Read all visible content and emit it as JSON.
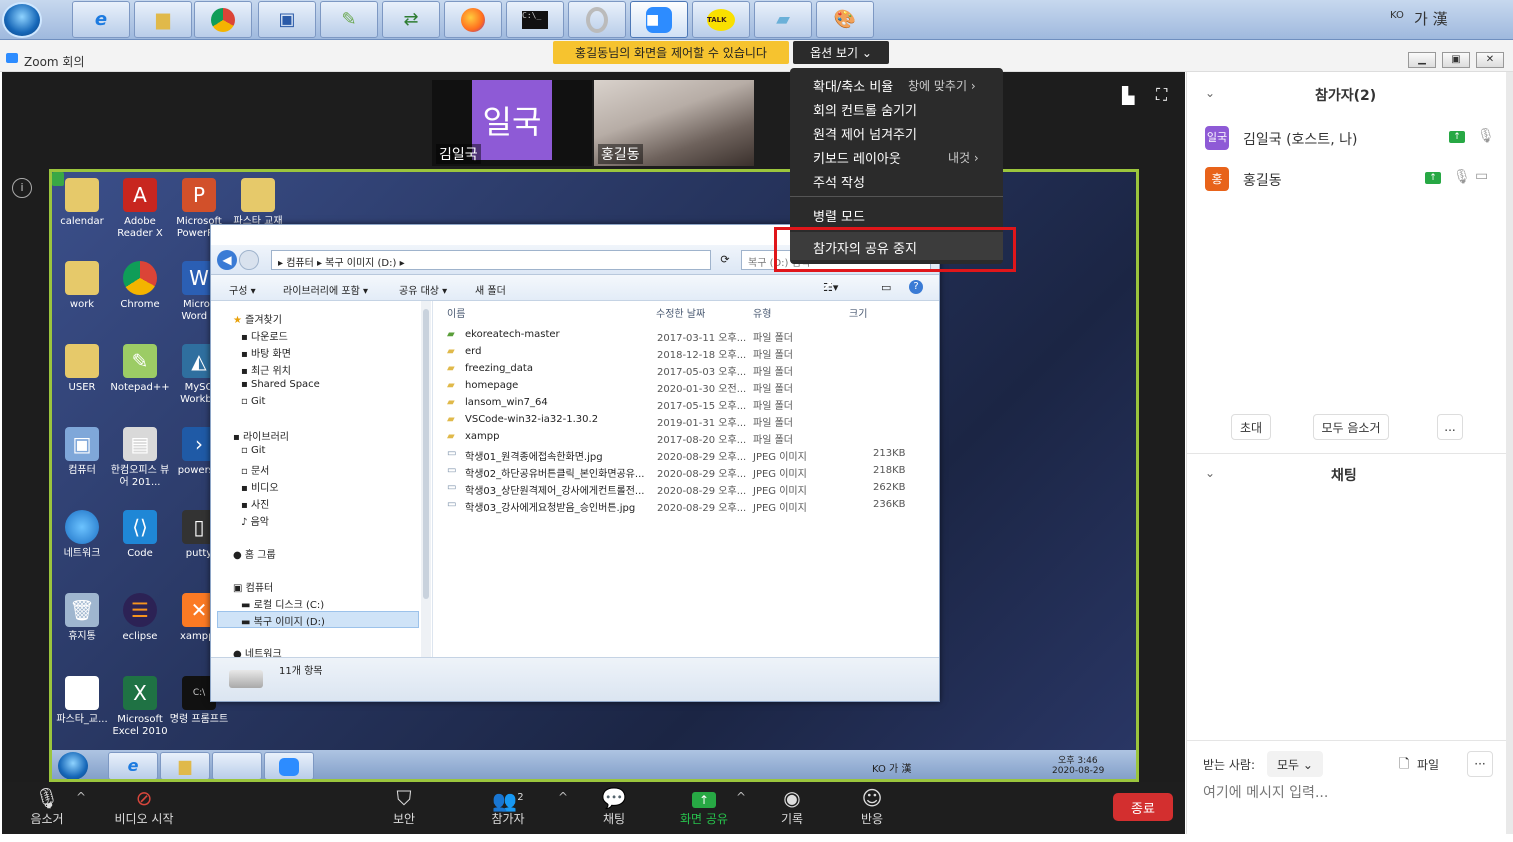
{
  "taskbar": {
    "apps": [
      "ie-icon",
      "folder-icon",
      "chrome-icon",
      "network-icon",
      "notepad-icon",
      "transfer-icon",
      "firefox-icon",
      "cmd-icon",
      "opera-icon",
      "zoom-icon",
      "kakaotalk-icon",
      "note-icon",
      "paint-icon"
    ],
    "kakao_label": "TALK",
    "ime_lang": "KO",
    "ime_text": "가 漢"
  },
  "zoom": {
    "title": "Zoom 회의",
    "banner": "홍길동님의 화면을 제어할 수 있습니다",
    "view_options": "옵션 보기 ⌄"
  },
  "thumbnails": [
    {
      "avatar_text": "일국",
      "name": "김일국"
    },
    {
      "name": "홍길동"
    }
  ],
  "menu": {
    "items": [
      {
        "label": "확대/축소 비율",
        "value": "창에 맞추기 ›"
      },
      {
        "label": "회의 컨트롤 숨기기"
      },
      {
        "label": "원격 제어 넘겨주기"
      },
      {
        "label": "키보드 레이아웃",
        "value": "내것 ›"
      },
      {
        "label": "주석 작성"
      },
      {
        "label": "병렬 모드"
      },
      {
        "label": "참가자의 공유 중지"
      }
    ]
  },
  "desktop_icons": [
    {
      "label": "calendar"
    },
    {
      "label": "Adobe Reader X"
    },
    {
      "label": "Microsoft PowerP..."
    },
    {
      "label": "파스타 교재"
    },
    {
      "label": "work"
    },
    {
      "label": "Chrome"
    },
    {
      "label": "Micros Word 2"
    },
    {
      "label": "USER"
    },
    {
      "label": "Notepad++"
    },
    {
      "label": "MySQ Workbe"
    },
    {
      "label": "컴퓨터"
    },
    {
      "label": "한컴오피스 뷰어 201..."
    },
    {
      "label": "powersh"
    },
    {
      "label": "네트워크"
    },
    {
      "label": "Code"
    },
    {
      "label": "putty"
    },
    {
      "label": "휴지통"
    },
    {
      "label": "eclipse"
    },
    {
      "label": "xampp-"
    },
    {
      "label": "파스타_교..."
    },
    {
      "label": "Microsoft Excel 2010"
    },
    {
      "label": "명령 프롬프트"
    }
  ],
  "explorer": {
    "breadcrumb": "▸ 컴퓨터 ▸ 복구 이미지 (D:) ▸",
    "search_placeholder": "복구 (D:) 검색",
    "commands": [
      "구성 ▾",
      "라이브러리에 포함 ▾",
      "공유 대상 ▾",
      "새 폴더"
    ],
    "nav": [
      "즐겨찾기",
      "다운로드",
      "바탕 화면",
      "최근 위치",
      "Shared Space",
      "Git",
      "라이브러리",
      "Git",
      "문서",
      "비디오",
      "사진",
      "음악",
      "홈 그룹",
      "컴퓨터",
      "로컬 디스크 (C:)",
      "복구 이미지 (D:)",
      "네트워크"
    ],
    "columns": [
      "이름",
      "수정한 날짜",
      "유형",
      "크기"
    ],
    "files": [
      {
        "name": "ekoreatech-master",
        "date": "2017-03-11 오후...",
        "type": "파일 폴더",
        "size": ""
      },
      {
        "name": "erd",
        "date": "2018-12-18 오후...",
        "type": "파일 폴더",
        "size": ""
      },
      {
        "name": "freezing_data",
        "date": "2017-05-03 오후...",
        "type": "파일 폴더",
        "size": ""
      },
      {
        "name": "homepage",
        "date": "2020-01-30 오전...",
        "type": "파일 폴더",
        "size": ""
      },
      {
        "name": "lansom_win7_64",
        "date": "2017-05-15 오후...",
        "type": "파일 폴더",
        "size": ""
      },
      {
        "name": "VSCode-win32-ia32-1.30.2",
        "date": "2019-01-31 오후...",
        "type": "파일 폴더",
        "size": ""
      },
      {
        "name": "xampp",
        "date": "2017-08-20 오후...",
        "type": "파일 폴더",
        "size": ""
      },
      {
        "name": "학생01_원격종에접속한화면.jpg",
        "date": "2020-08-29 오후...",
        "type": "JPEG 이미지",
        "size": "213KB"
      },
      {
        "name": "학생02_하단공유버튼클릭_본인화면공유...",
        "date": "2020-08-29 오후...",
        "type": "JPEG 이미지",
        "size": "218KB"
      },
      {
        "name": "학생03_상단원격제어_강사에게컨트롤전...",
        "date": "2020-08-29 오후...",
        "type": "JPEG 이미지",
        "size": "262KB"
      },
      {
        "name": "학생03_강사에게요청받음_승인버튼.jpg",
        "date": "2020-08-29 오후...",
        "type": "JPEG 이미지",
        "size": "236KB"
      }
    ],
    "status": "11개 항목"
  },
  "inner_taskbar": {
    "time": "오후 3:46",
    "date": "2020-08-29",
    "tray": "KO 가 漢"
  },
  "participants": {
    "title": "참가자(2)",
    "list": [
      {
        "avatar": "일국",
        "name": "김일국 (호스트, 나)",
        "color": "#8e5ad6"
      },
      {
        "avatar": "홍",
        "name": "홍길동",
        "color": "#e8631a"
      }
    ],
    "invite": "초대",
    "mute_all": "모두 음소거",
    "more": "..."
  },
  "chat": {
    "title": "채팅",
    "to_label": "받는 사람:",
    "to_value": "모두 ⌄",
    "file": "파일",
    "more": "···",
    "placeholder": "여기에 메시지 입력..."
  },
  "toolbar": {
    "mute": "음소거",
    "video": "비디오 시작",
    "security": "보안",
    "participants": "참가자",
    "participants_count": "2",
    "chat": "채팅",
    "share": "화면 공유",
    "record": "기록",
    "reactions": "반응",
    "end": "종료"
  }
}
